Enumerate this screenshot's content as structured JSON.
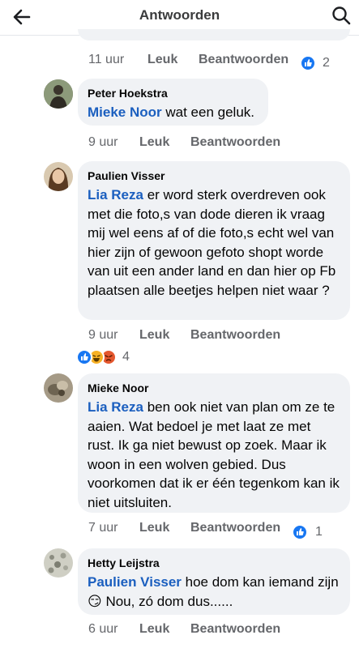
{
  "header": {
    "title": "Antwoorden",
    "back_icon": "arrow-left-icon",
    "search_icon": "search-icon"
  },
  "colors": {
    "mention": "#1b5fbf",
    "bubble": "#f0f2f5",
    "like_blue": "#1877f2",
    "angry": "#e4572e",
    "haha": "#f7b125"
  },
  "comments": [
    {
      "time": "11 uur",
      "like_label": "Leuk",
      "reply_label": "Beantwoorden",
      "reactions": [
        "like"
      ],
      "reaction_count": "2"
    },
    {
      "author": "Peter Hoekstra",
      "mention": "Mieke Noor",
      "text": " wat een geluk.",
      "time": "9 uur",
      "like_label": "Leuk",
      "reply_label": "Beantwoorden"
    },
    {
      "author": "Paulien Visser",
      "mention": "Lia Reza",
      "text": " er word sterk overdreven ook met die foto,s van dode dieren ik vraag mij wel eens af of die foto,s echt wel van hier zijn of gewoon gefoto shopt worde van uit een ander land en dan hier  op Fb plaatsen alle beetjes helpen niet waar ?",
      "time": "9 uur",
      "like_label": "Leuk",
      "reply_label": "Beantwoorden",
      "reactions": [
        "like",
        "haha",
        "angry"
      ],
      "reaction_count": "4"
    },
    {
      "author": "Mieke Noor",
      "mention": "Lia Reza",
      "text": " ben ook niet van plan om ze te aaien. Wat bedoel je met laat ze met rust. Ik ga niet bewust op zoek. Maar ik woon in een wolven gebied. Dus voorkomen dat ik er één tegenkom kan ik niet uitsluiten.",
      "time": "7 uur",
      "like_label": "Leuk",
      "reply_label": "Beantwoorden",
      "reactions": [
        "like"
      ],
      "reaction_count": "1"
    },
    {
      "author": "Hetty Leijstra",
      "mention": "Paulien Visser",
      "text": " hoe dom kan iemand zijn 😏 Nou, zó dom dus......",
      "time": "6 uur",
      "like_label": "Leuk",
      "reply_label": "Beantwoorden"
    }
  ]
}
